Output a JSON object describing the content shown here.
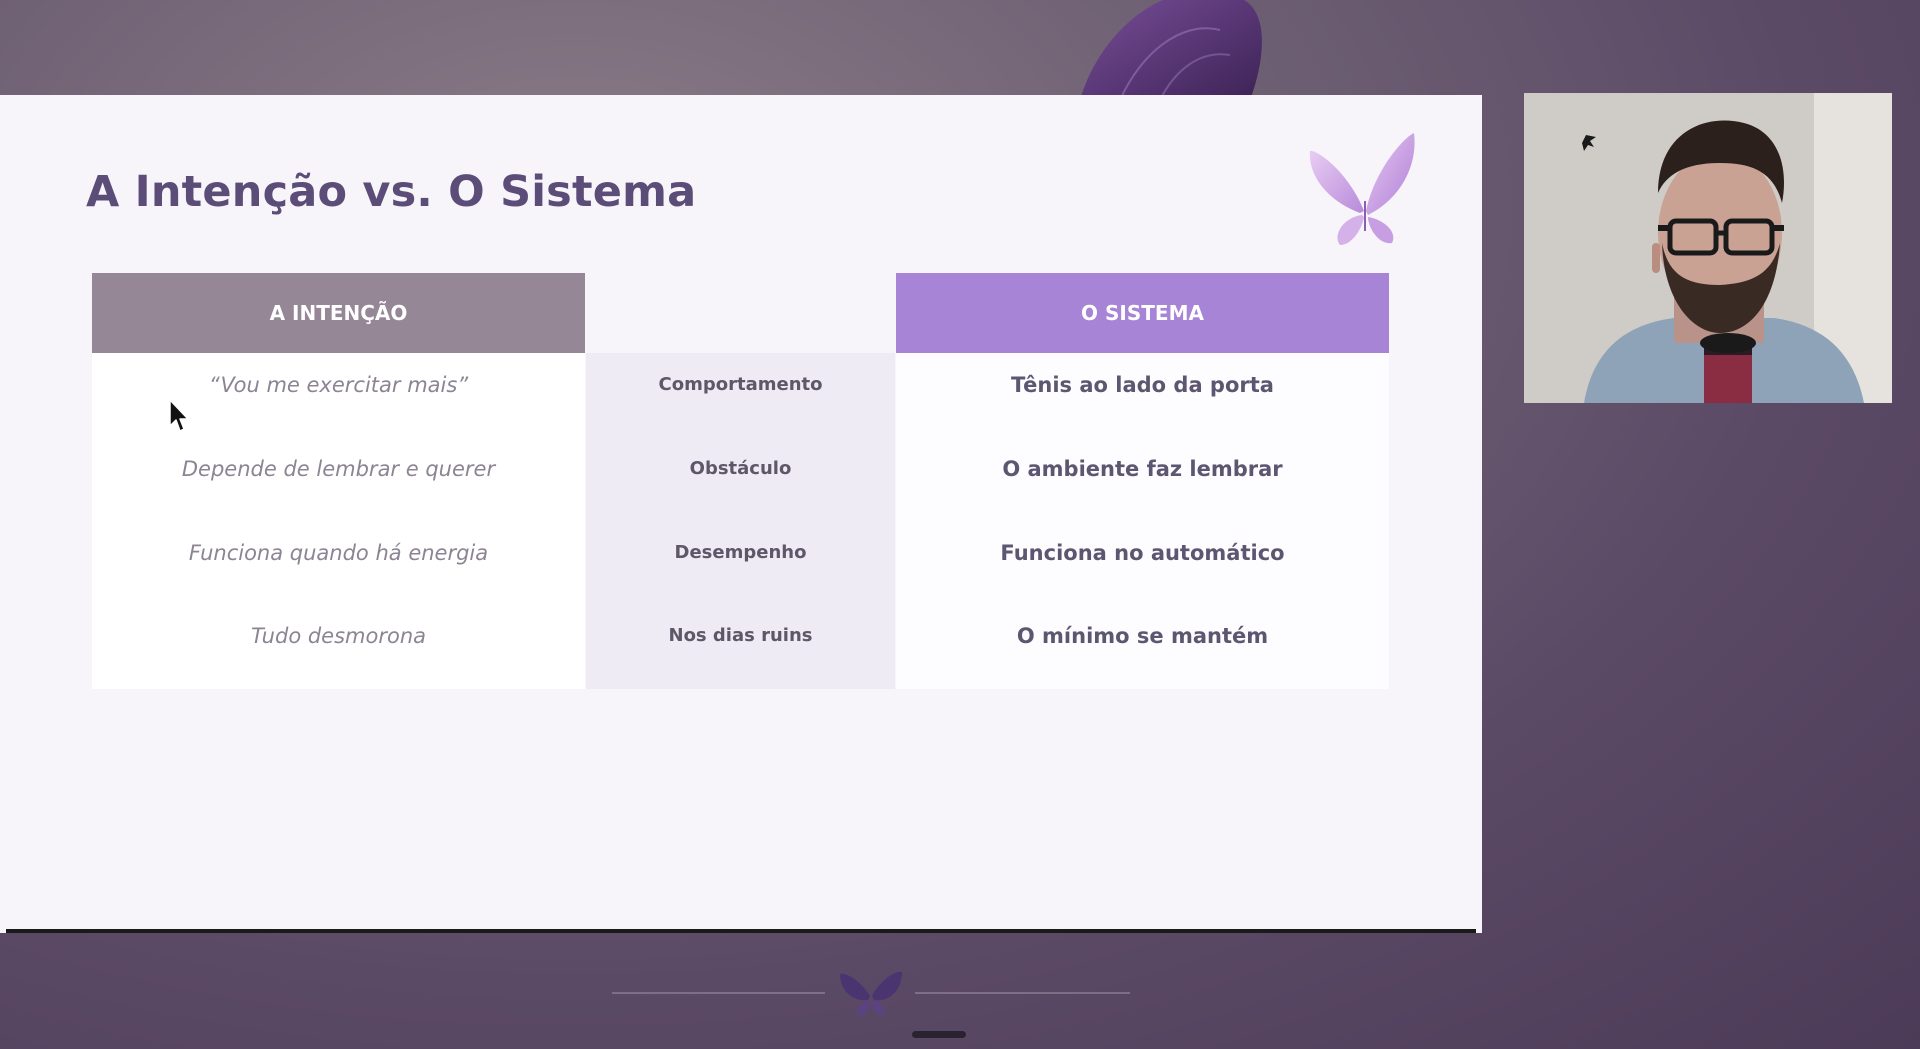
{
  "slide": {
    "title": "A Intenção vs. O Sistema"
  },
  "table": {
    "left_header": "A INTENÇÃO",
    "right_header": "O SISTEMA",
    "rows": [
      {
        "intention": "“Vou me exercitar mais”",
        "criterion": "Comportamento",
        "system": "Tênis ao lado da porta"
      },
      {
        "intention": "Depende de lembrar e querer",
        "criterion": "Obstáculo",
        "system": "O ambiente faz lembrar"
      },
      {
        "intention": "Funciona quando há energia",
        "criterion": "Desempenho",
        "system": "Funciona no automático"
      },
      {
        "intention": "Tudo desmorona",
        "criterion": "Nos dias ruins",
        "system": "O mínimo se mantém"
      }
    ]
  },
  "colors": {
    "left_header_bg": "#958796",
    "right_header_bg": "#a784d6",
    "middle_column_bg": "#eeebf5",
    "title_color": "#5b4d78",
    "background": "#5b4a66"
  },
  "icons": {
    "slide_decoration": "butterfly-icon",
    "bottom_decoration": "butterfly-icon",
    "pointer": "mouse-cursor-icon"
  }
}
